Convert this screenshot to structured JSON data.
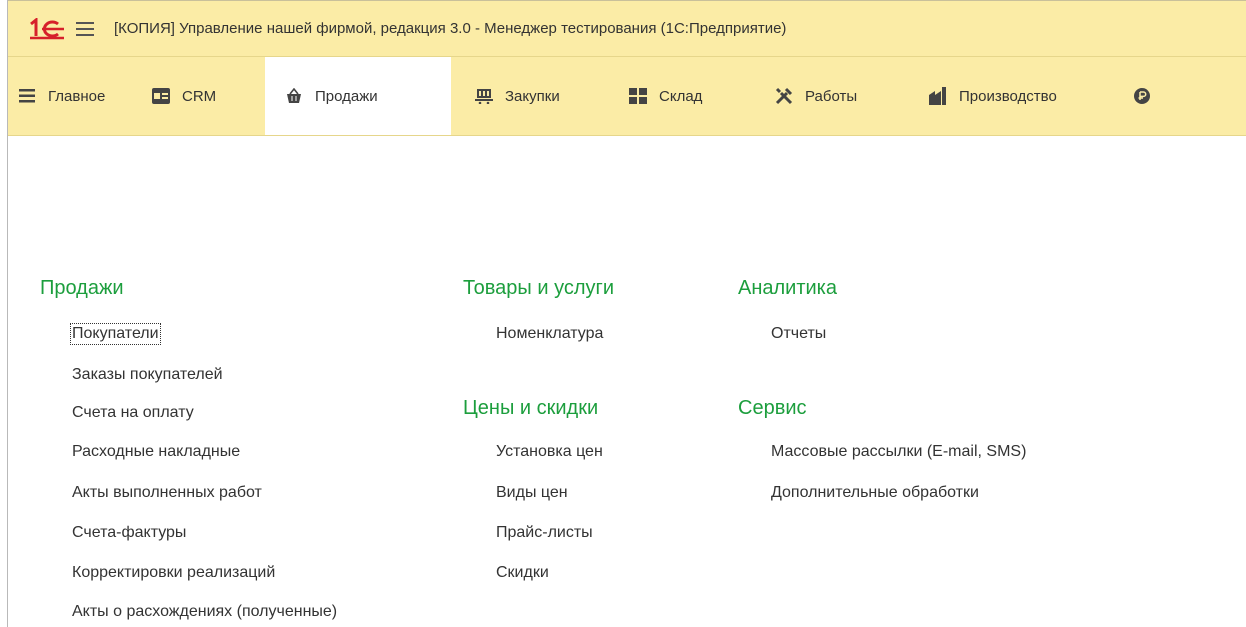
{
  "window": {
    "title": "[КОПИЯ] Управление нашей фирмой, редакция 3.0  - Менеджер тестирования (1С:Предприятие)"
  },
  "sections": [
    {
      "label": "Главное",
      "icon": "menu-lines-icon"
    },
    {
      "label": "CRM",
      "icon": "contact-card-icon"
    },
    {
      "label": "Продажи",
      "icon": "basket-icon",
      "active": true
    },
    {
      "label": "Закупки",
      "icon": "cart-icon"
    },
    {
      "label": "Склад",
      "icon": "warehouse-icon"
    },
    {
      "label": "Работы",
      "icon": "tools-icon"
    },
    {
      "label": "Производство",
      "icon": "factory-icon"
    }
  ],
  "groups": {
    "sales": {
      "title": "Продажи",
      "items": [
        "Покупатели",
        "Заказы покупателей",
        "Счета на оплату",
        "Расходные накладные",
        "Акты выполненных работ",
        "Счета-фактуры",
        "Корректировки реализаций",
        "Акты о расхождениях (полученные)"
      ]
    },
    "goods": {
      "title": "Товары и услуги",
      "items": [
        "Номенклатура"
      ]
    },
    "prices": {
      "title": "Цены и скидки",
      "items": [
        "Установка цен",
        "Виды цен",
        "Прайс-листы",
        "Скидки"
      ]
    },
    "analytics": {
      "title": "Аналитика",
      "items": [
        "Отчеты"
      ]
    },
    "service": {
      "title": "Сервис",
      "items": [
        "Массовые рассылки (E-mail, SMS)",
        "Дополнительные обработки"
      ]
    }
  },
  "colors": {
    "panel_bg": "#fbeca6",
    "group_title": "#1c9e3d",
    "active_section_bg": "#ffffff"
  }
}
